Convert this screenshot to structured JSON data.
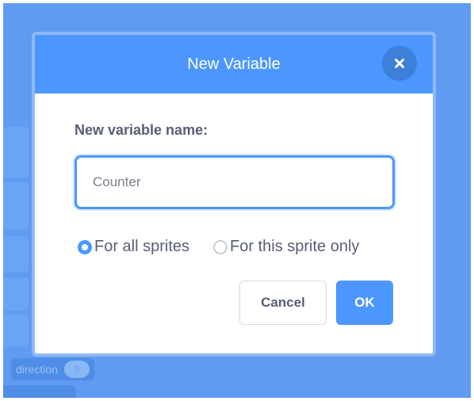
{
  "dialog": {
    "title": "New Variable",
    "close_icon": "close-icon",
    "field_label": "New variable name:",
    "input_value": "Counter",
    "radio_options": [
      {
        "label": "For all sprites",
        "checked": true
      },
      {
        "label": "For this sprite only",
        "checked": false
      }
    ],
    "cancel_label": "Cancel",
    "ok_label": "OK"
  },
  "background": {
    "block_label": "direction",
    "block_value": "0"
  },
  "colors": {
    "accent": "#4c97ff",
    "overlay": "#5f9bf0",
    "text": "#575e75"
  }
}
